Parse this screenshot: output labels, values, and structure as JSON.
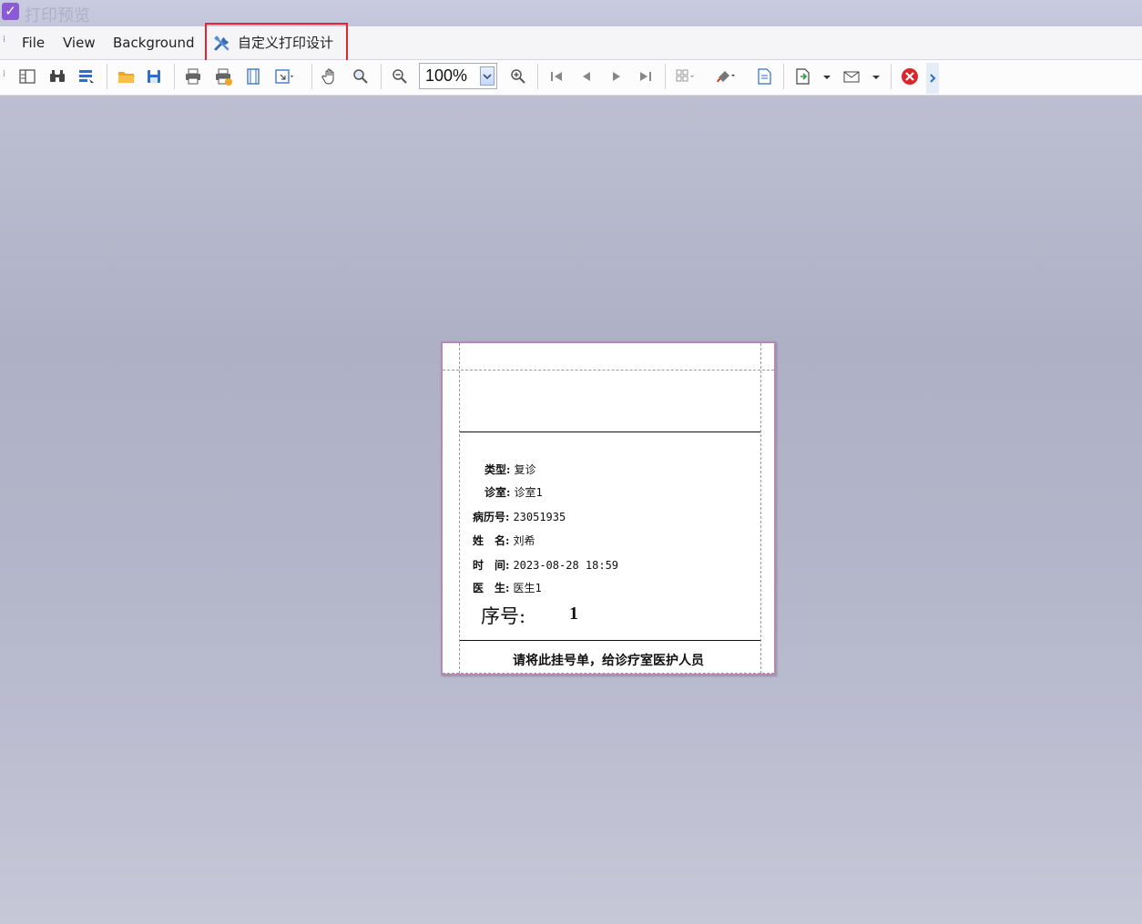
{
  "window": {
    "title": "打印预览",
    "app_icon": "check-icon"
  },
  "menu": {
    "file": "File",
    "view": "View",
    "background": "Background",
    "custom_design": "自定义打印设计",
    "custom_design_icon": "tools-icon",
    "highlight_color": "#e0272b"
  },
  "toolbar": {
    "zoom_value": "100%",
    "icons": [
      "document-map-icon",
      "find-icon",
      "thumbnails-icon",
      "open-icon",
      "save-icon",
      "print-icon",
      "quick-print-icon",
      "page-setup-icon",
      "scale-icon",
      "hand-tool-icon",
      "magnifier-icon",
      "zoom-out-icon",
      "zoom-in-icon",
      "first-page-icon",
      "previous-page-icon",
      "next-page-icon",
      "last-page-icon",
      "multiple-pages-icon",
      "color-icon",
      "watermark-icon",
      "export-icon",
      "send-email-icon",
      "close-preview-icon",
      "more-icon"
    ]
  },
  "ticket": {
    "fields": [
      {
        "label": "类型:",
        "value": "复诊"
      },
      {
        "label": "诊室:",
        "value": "诊室1"
      },
      {
        "label": "病历号:",
        "value": "23051935"
      },
      {
        "label": "姓　名:",
        "value": "刘希"
      },
      {
        "label": "时　间:",
        "value": "2023-08-28 18:59"
      },
      {
        "label": "医　生:",
        "value": "医生1"
      }
    ],
    "seq_label": "序号:",
    "seq_value": "1",
    "footer": "请将此挂号单，给诊疗室医护人员"
  }
}
